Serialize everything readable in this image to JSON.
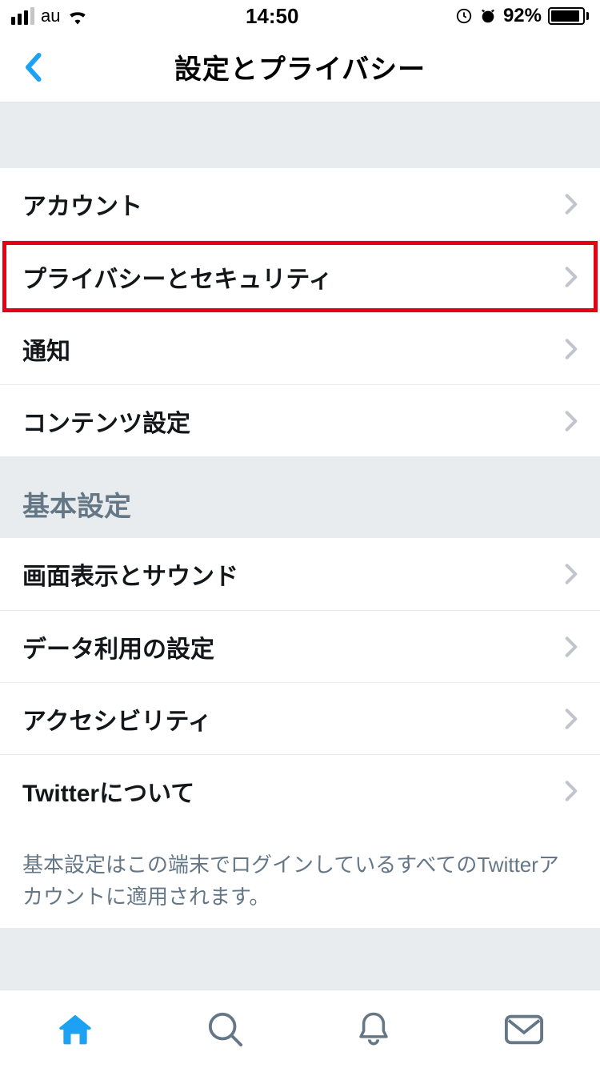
{
  "status_bar": {
    "carrier": "au",
    "time": "14:50",
    "battery_pct": "92%"
  },
  "header": {
    "title": "設定とプライバシー"
  },
  "section1": {
    "items": [
      {
        "label": "アカウント"
      },
      {
        "label": "プライバシーとセキュリティ"
      },
      {
        "label": "通知"
      },
      {
        "label": "コンテンツ設定"
      }
    ]
  },
  "section2": {
    "header": "基本設定",
    "items": [
      {
        "label": "画面表示とサウンド"
      },
      {
        "label": "データ利用の設定"
      },
      {
        "label": "アクセシビリティ"
      },
      {
        "label": "Twitterについて"
      }
    ],
    "footer_note": "基本設定はこの端末でログインしているすべてのTwitterアカウントに適用されます。"
  },
  "colors": {
    "accent": "#1da1f2",
    "highlight": "#e60012"
  }
}
